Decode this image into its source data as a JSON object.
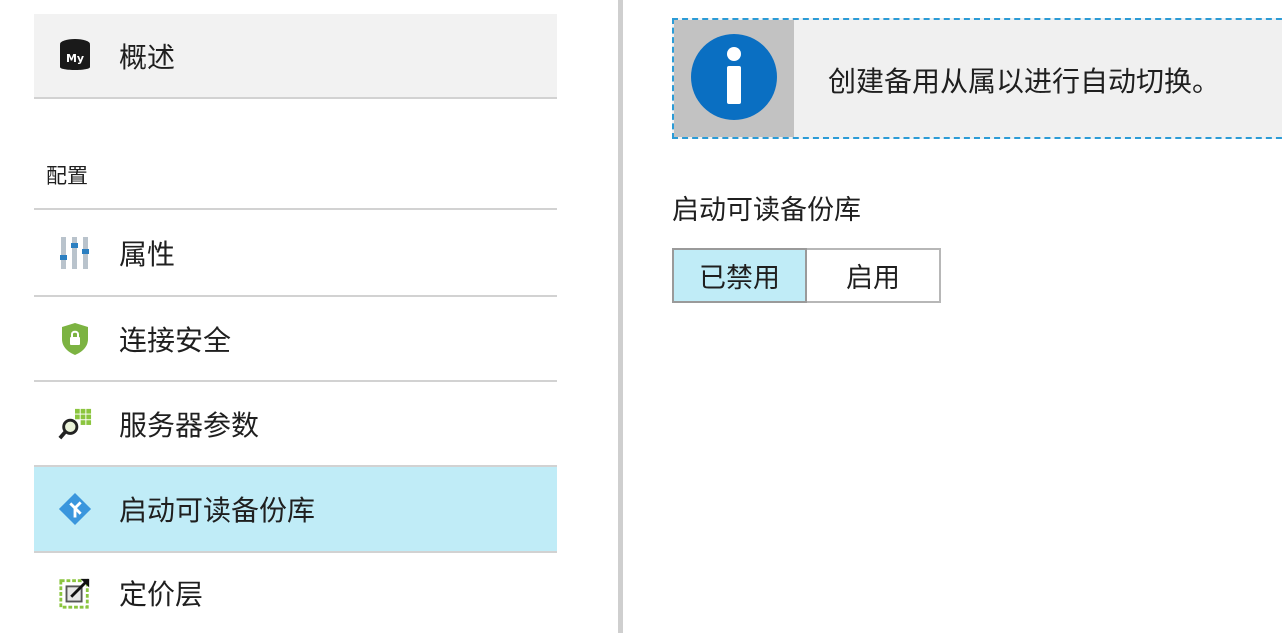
{
  "sidebar": {
    "overview": {
      "label": "概述",
      "icon": "mysql-database-icon"
    },
    "section_header": "配置",
    "items": [
      {
        "label": "属性",
        "icon": "properties-icon"
      },
      {
        "label": "连接安全",
        "icon": "shield-lock-icon"
      },
      {
        "label": "服务器参数",
        "icon": "server-parameters-icon"
      },
      {
        "label": "启动可读备份库",
        "icon": "replica-icon",
        "selected": true
      },
      {
        "label": "定价层",
        "icon": "pricing-tier-icon"
      }
    ]
  },
  "main": {
    "info_banner": {
      "text": "创建备用从属以进行自动切换。",
      "icon": "info-icon"
    },
    "field_label": "启动可读备份库",
    "toggle": {
      "options": [
        "已禁用",
        "启用"
      ],
      "selected": "已禁用"
    }
  },
  "colors": {
    "selected_bg": "#c0ecf7",
    "info_blue": "#0078d4",
    "banner_border": "#2b9bd6",
    "accent_green": "#8bc53f"
  }
}
